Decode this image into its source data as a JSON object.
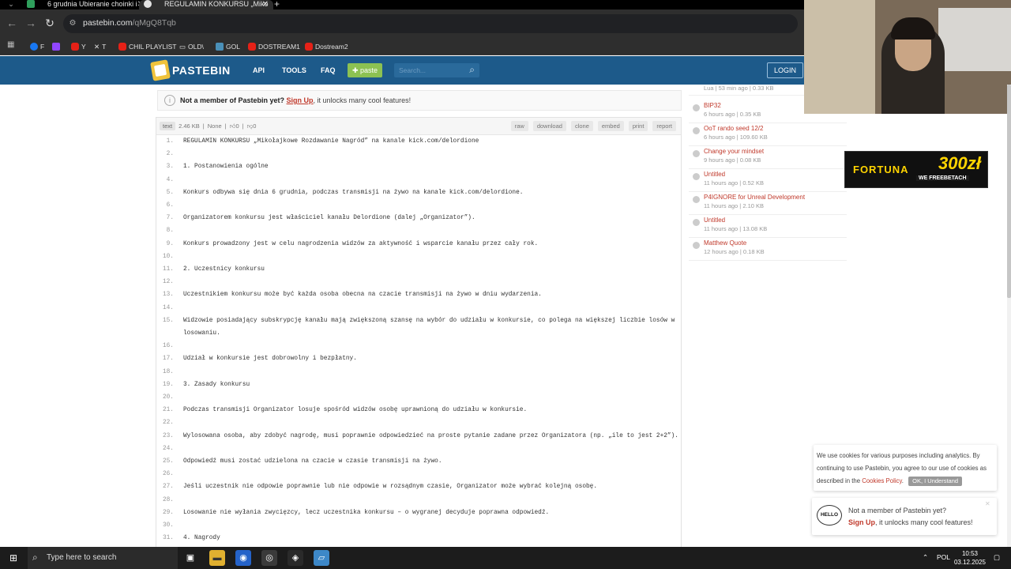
{
  "browser": {
    "tabs": [
      {
        "title": "6 grudnia Ubieranie choinki i n",
        "active": false
      },
      {
        "title": "REGULAMIN KONKURSU „Miko",
        "active": true
      }
    ],
    "url": "pastebin.com",
    "url_path": "/qMgQ8Tqb",
    "bookmarks": [
      "F",
      "Y",
      "T",
      "CHIL PLAYLIST",
      "OLD\\",
      "GOL",
      "DOSTREAM1",
      "Dostream2"
    ]
  },
  "header": {
    "logo": "PASTEBIN",
    "nav": [
      "API",
      "TOOLS",
      "FAQ"
    ],
    "paste_label": "paste",
    "search_placeholder": "Search...",
    "login_label": "LOGIN"
  },
  "notice": {
    "prefix": "Not a member of Pastebin yet?",
    "link": "Sign Up",
    "suffix": ", it unlocks many cool features!"
  },
  "paste": {
    "syntax": "text",
    "size": "2.46 KB",
    "expire": "None",
    "likes": "0",
    "dislikes": "0",
    "actions": [
      "raw",
      "download",
      "clone",
      "embed",
      "print",
      "report"
    ],
    "lines": [
      {
        "n": "1.",
        "t": "REGULAMIN KONKURSU „Mikołajkowe Rozdawanie Nagród” na kanale kick.com/delordione"
      },
      {
        "n": "2.",
        "t": ""
      },
      {
        "n": "3.",
        "t": "1. Postanowienia ogólne"
      },
      {
        "n": "4.",
        "t": ""
      },
      {
        "n": "5.",
        "t": "Konkurs odbywa się dnia 6 grudnia, podczas transmisji na żywo na kanale kick.com/delordione."
      },
      {
        "n": "6.",
        "t": ""
      },
      {
        "n": "7.",
        "t": "Organizatorem konkursu jest właściciel kanału Delordione (dalej „Organizator”)."
      },
      {
        "n": "8.",
        "t": ""
      },
      {
        "n": "9.",
        "t": "Konkurs prowadzony jest w celu nagrodzenia widzów za aktywność i wsparcie kanału przez cały rok."
      },
      {
        "n": "10.",
        "t": ""
      },
      {
        "n": "11.",
        "t": "2. Uczestnicy konkursu"
      },
      {
        "n": "12.",
        "t": ""
      },
      {
        "n": "13.",
        "t": "Uczestnikiem konkursu może być każda osoba obecna na czacie transmisji na żywo w dniu wydarzenia."
      },
      {
        "n": "14.",
        "t": ""
      },
      {
        "n": "15.",
        "t": "Widzowie posiadający subskrypcję kanału mają zwiększoną szansę na wybór do udziału w konkursie, co polega na większej liczbie losów w losowaniu."
      },
      {
        "n": "16.",
        "t": ""
      },
      {
        "n": "17.",
        "t": "Udział w konkursie jest dobrowolny i bezpłatny."
      },
      {
        "n": "18.",
        "t": ""
      },
      {
        "n": "19.",
        "t": "3. Zasady konkursu"
      },
      {
        "n": "20.",
        "t": ""
      },
      {
        "n": "21.",
        "t": "Podczas transmisji Organizator losuje spośród widzów osobę uprawnioną do udziału w konkursie."
      },
      {
        "n": "22.",
        "t": ""
      },
      {
        "n": "23.",
        "t": "Wylosowana osoba, aby zdobyć nagrodę, musi poprawnie odpowiedzieć na proste pytanie zadane przez Organizatora (np. „ile to jest 2+2”)."
      },
      {
        "n": "24.",
        "t": ""
      },
      {
        "n": "25.",
        "t": "Odpowiedź musi zostać udzielona na czacie w czasie transmisji na żywo."
      },
      {
        "n": "26.",
        "t": ""
      },
      {
        "n": "27.",
        "t": "Jeśli uczestnik nie odpowie poprawnie lub nie odpowie w rozsądnym czasie, Organizator może wybrać kolejną osobę."
      },
      {
        "n": "28.",
        "t": ""
      },
      {
        "n": "29.",
        "t": "Losowanie nie wyłania zwycięzcy, lecz uczestnika konkursu – o wygranej decyduje poprawna odpowiedź."
      },
      {
        "n": "30.",
        "t": ""
      },
      {
        "n": "31.",
        "t": "4. Nagrody"
      }
    ]
  },
  "sidebar": {
    "recent": [
      {
        "title": "",
        "meta": "Lua | 53 min ago | 0.33 KB"
      },
      {
        "title": "BIP32",
        "meta": "6 hours ago | 0.35 KB"
      },
      {
        "title": "OoT rando seed 12/2",
        "meta": "6 hours ago | 109.60 KB"
      },
      {
        "title": "Change your mindset",
        "meta": "9 hours ago | 0.08 KB"
      },
      {
        "title": "Untitled",
        "meta": "11 hours ago | 0.52 KB"
      },
      {
        "title": "P4IGNORE for Unreal Development",
        "meta": "11 hours ago | 2.10 KB"
      },
      {
        "title": "Untitled",
        "meta": "11 hours ago | 13.08 KB"
      },
      {
        "title": "Matthew Quote",
        "meta": "12 hours ago | 0.18 KB"
      }
    ]
  },
  "ad": {
    "brand": "FORTUNA",
    "amount": "300zł",
    "sub": "WE FREEBETACH"
  },
  "cookie": {
    "text_prefix": "We use cookies for various purposes including analytics. By continuing to use Pastebin, you agree to our use of cookies as described in the",
    "link": "Cookies Policy",
    "button": "OK, I Understand"
  },
  "signup_popup": {
    "icon_text": "HELLO",
    "title": "Not a member of Pastebin yet?",
    "link": "Sign Up",
    "suffix": ", it unlocks many cool features!"
  },
  "taskbar": {
    "search_placeholder": "Type here to search",
    "lang": "POL",
    "time": "10:53",
    "date": "03.12.2025"
  },
  "colors": {
    "header": "#1d5a8a",
    "link": "#c0392b",
    "paste_btn": "#8cc152"
  }
}
